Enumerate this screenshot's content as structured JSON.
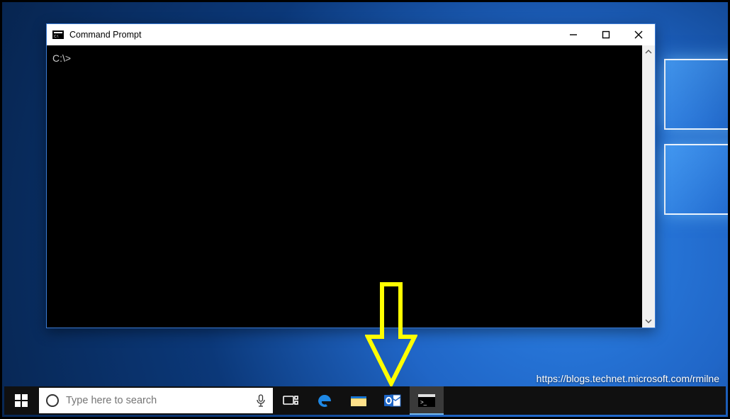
{
  "window": {
    "title": "Command Prompt",
    "terminal_content": "C:\\>"
  },
  "taskbar": {
    "search_placeholder": "Type here to search"
  },
  "attribution": "https://blogs.technet.microsoft.com/rmilne",
  "annotation": {
    "color": "#ffff00"
  }
}
